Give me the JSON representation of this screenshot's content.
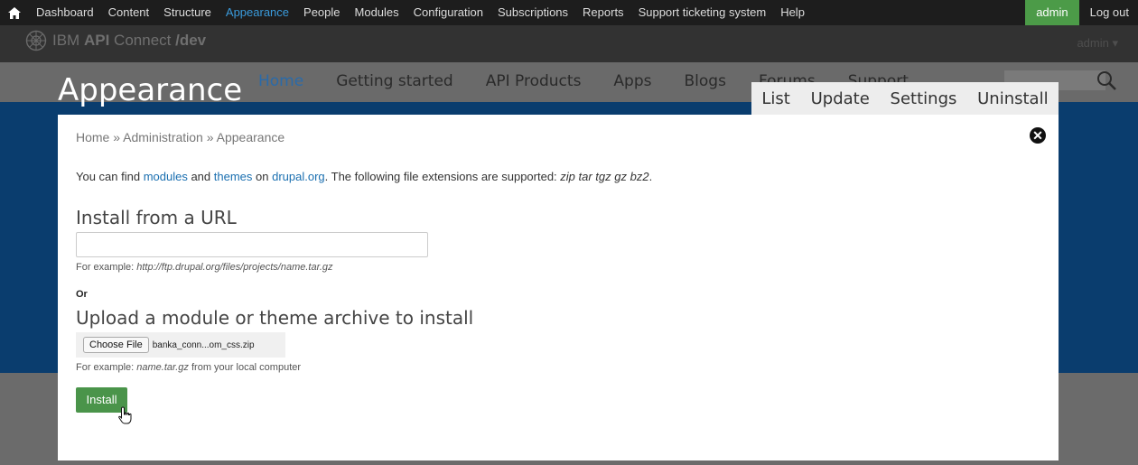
{
  "toolbar": {
    "home_icon": "home-icon",
    "items": [
      "Dashboard",
      "Content",
      "Structure",
      "Appearance",
      "People",
      "Modules",
      "Configuration",
      "Subscriptions",
      "Reports",
      "Support ticketing system",
      "Help"
    ],
    "active": "Appearance",
    "user": "admin",
    "logout": "Log out",
    "accent_color": "#4c9b48",
    "active_color": "#3a9bdc"
  },
  "header": {
    "brand_prefix": "IBM",
    "brand_bold": "API",
    "brand_mid": "Connect",
    "brand_suffix": "/dev",
    "user_menu": "admin ▾"
  },
  "page": {
    "title": "Appearance",
    "nav": [
      "Home",
      "Getting started",
      "API Products",
      "Apps",
      "Blogs",
      "Forums",
      "Support"
    ]
  },
  "tabs": [
    "List",
    "Update",
    "Settings",
    "Uninstall"
  ],
  "modal": {
    "breadcrumb": "Home » Administration » Appearance",
    "intro": {
      "pre": "You can find ",
      "link_modules": "modules",
      "and": " and ",
      "link_themes": "themes",
      "on": " on ",
      "link_drupal": "drupal.org",
      "post": ". The following file extensions are supported: ",
      "extensions": "zip tar tgz gz bz2",
      "end": "."
    },
    "url_heading": "Install from a URL",
    "url_value": "",
    "url_hint_pre": "For example: ",
    "url_hint_example": "http://ftp.drupal.org/files/projects/name.tar.gz",
    "or": "Or",
    "upload_heading": "Upload a module or theme archive to install",
    "file_button": "Choose File",
    "file_name": "banka_conn...om_css.zip",
    "upload_hint_pre": "For example: ",
    "upload_hint_example": "name.tar.gz",
    "upload_hint_post": " from your local computer",
    "install_button": "Install",
    "close_icon": "close-icon"
  }
}
